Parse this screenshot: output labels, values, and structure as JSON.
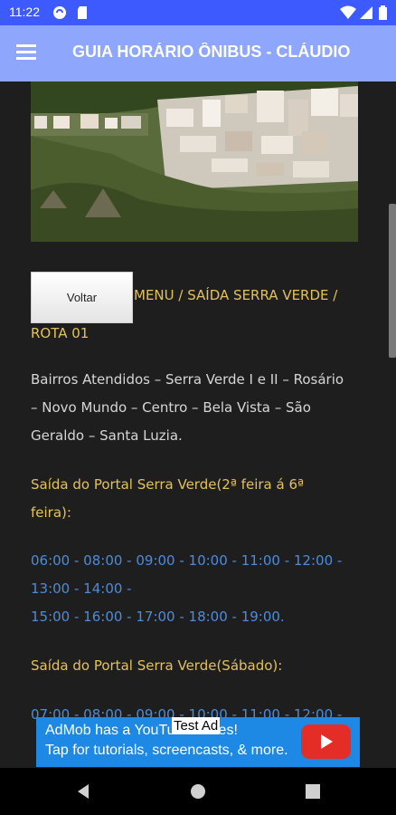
{
  "status_bar": {
    "time": "11:22",
    "icons": [
      "cloud-sync-icon",
      "sd-card-icon",
      "wifi-icon",
      "cell-signal-icon",
      "battery-icon"
    ]
  },
  "app_bar": {
    "title": "GUIA HORÁRIO ÔNIBUS - CLÁUDIO",
    "menu_icon": "hamburger-menu-icon",
    "color": "#8ea6fb"
  },
  "content": {
    "back_button": "Voltar",
    "breadcrumb": {
      "menu": "MENU",
      "sep1": "/",
      "route_origin": "SAÍDA SERRA VERDE",
      "sep2": "/",
      "route": "ROTA 01"
    },
    "bairros": {
      "line1": "Bairros Atendidos – Serra Verde I e II – Rosário",
      "line2": "– Novo Mundo – Centro – Bela Vista – São",
      "line3": "Geraldo – Santa Luzia."
    },
    "weekday": {
      "heading_line1": "Saída do Portal Serra Verde(2ª feira á 6ª",
      "heading_line2": "feira):",
      "times_line1": "06:00 - 08:00 - 09:00 - 10:00 - 11:00 - 12:00 -",
      "times_line2": "13:00 - 14:00 -",
      "times_line3": "15:00 - 16:00 - 17:00 - 18:00 - 19:00."
    },
    "saturday": {
      "heading": "Saída do Portal Serra Verde(Sábado):",
      "times_line1": "07:00 - 08:00 - 09:00 - 10:00 - 11:00 - 12:00 -"
    },
    "colors": {
      "heading": "#e3c25b",
      "times": "#4f8bd8",
      "body": "#d6d6d6"
    }
  },
  "ad": {
    "line1": "AdMob has a YouTube series!",
    "line2": "Tap for tutorials, screencasts, & more.",
    "tag": "Test Ad",
    "icon": "youtube-play-icon"
  },
  "nav_bar": {
    "icons": [
      "back-triangle-icon",
      "home-circle-icon",
      "recents-square-icon"
    ]
  }
}
